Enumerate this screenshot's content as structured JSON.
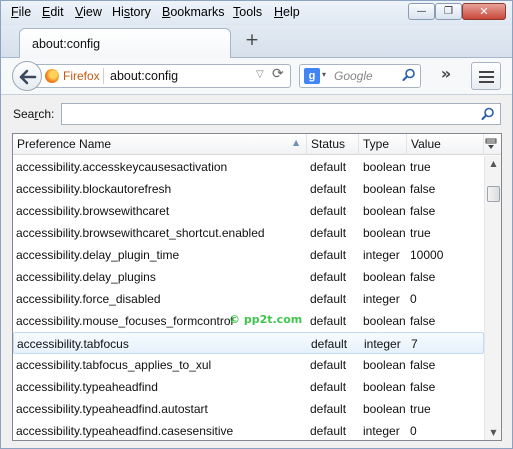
{
  "menubar": {
    "items": [
      {
        "accel": "F",
        "rest": "ile"
      },
      {
        "accel": "E",
        "rest": "dit"
      },
      {
        "accel": "V",
        "rest": "iew"
      },
      {
        "pre": "Hi",
        "accel": "s",
        "rest": "tory"
      },
      {
        "accel": "B",
        "rest": "ookmarks"
      },
      {
        "accel": "T",
        "rest": "ools"
      },
      {
        "accel": "H",
        "rest": "elp"
      }
    ],
    "window_buttons": {
      "minimize": "—",
      "maximize": "❐",
      "close": "✕"
    }
  },
  "tabs": [
    {
      "label": "about:config",
      "active": true
    }
  ],
  "new_tab_glyph": "+",
  "navbar": {
    "identity_label": "Firefox",
    "url": "about:config",
    "search_placeholder": "Google",
    "search_engine_glyph": "g",
    "overflow_glyph": "»",
    "icons": [
      "back-arrow-icon",
      "firefox-icon",
      "dropmarker-icon",
      "reload-icon",
      "google-icon",
      "magnifier-icon",
      "overflow-chevron-icon",
      "hamburger-menu-icon"
    ]
  },
  "config": {
    "search_label_accel": "r",
    "search_label_pre": "Sea",
    "search_label_post": "ch:",
    "filter_value": "",
    "columns": [
      "Preference Name",
      "Status",
      "Type",
      "Value"
    ],
    "rows": [
      {
        "name": "accessibility.accesskeycausesactivation",
        "status": "default",
        "type": "boolean",
        "value": "true"
      },
      {
        "name": "accessibility.blockautorefresh",
        "status": "default",
        "type": "boolean",
        "value": "false"
      },
      {
        "name": "accessibility.browsewithcaret",
        "status": "default",
        "type": "boolean",
        "value": "false"
      },
      {
        "name": "accessibility.browsewithcaret_shortcut.enabled",
        "status": "default",
        "type": "boolean",
        "value": "true"
      },
      {
        "name": "accessibility.delay_plugin_time",
        "status": "default",
        "type": "integer",
        "value": "10000"
      },
      {
        "name": "accessibility.delay_plugins",
        "status": "default",
        "type": "boolean",
        "value": "false"
      },
      {
        "name": "accessibility.force_disabled",
        "status": "default",
        "type": "integer",
        "value": "0"
      },
      {
        "name": "accessibility.mouse_focuses_formcontrol",
        "status": "default",
        "type": "boolean",
        "value": "false"
      },
      {
        "name": "accessibility.tabfocus",
        "status": "default",
        "type": "integer",
        "value": "7",
        "selected": true
      },
      {
        "name": "accessibility.tabfocus_applies_to_xul",
        "status": "default",
        "type": "boolean",
        "value": "false"
      },
      {
        "name": "accessibility.typeaheadfind",
        "status": "default",
        "type": "boolean",
        "value": "false"
      },
      {
        "name": "accessibility.typeaheadfind.autostart",
        "status": "default",
        "type": "boolean",
        "value": "true"
      },
      {
        "name": "accessibility.typeaheadfind.casesensitive",
        "status": "default",
        "type": "integer",
        "value": "0"
      }
    ]
  },
  "watermark": "© pp2t.com",
  "colors": {
    "accent": "#4285f4",
    "identity": "#c15a12",
    "selection": "#e6f1fb",
    "watermark": "#2bbf3a"
  }
}
